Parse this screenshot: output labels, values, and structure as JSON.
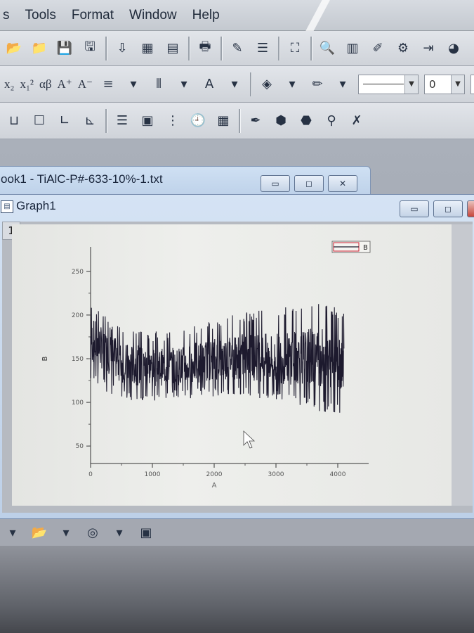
{
  "menu": [
    {
      "label": "s"
    },
    {
      "label": "Tools"
    },
    {
      "label": "Format"
    },
    {
      "label": "Window"
    },
    {
      "label": "Help"
    }
  ],
  "toolbar2": {
    "subscript": "x₂",
    "superscript": "x₁²",
    "greek": "αβ",
    "font_up": "A⁺",
    "font_down": "A⁻",
    "line_width_value": "",
    "number_value": "0"
  },
  "workbook": {
    "title": "ook1 - TiAlC-P#-633-10%-1.txt"
  },
  "graph_window": {
    "title": "Graph1",
    "layer_number": "1"
  },
  "icons": {
    "minimize": "▭",
    "restore": "◻",
    "close": "✕"
  },
  "chart_data": {
    "type": "line",
    "xlabel": "A",
    "ylabel": "B",
    "legend": {
      "entries": [
        "B"
      ],
      "placement": "top-right"
    },
    "xlim": [
      0,
      4500
    ],
    "ylim": [
      30,
      270
    ],
    "x_ticks": [
      0,
      1000,
      2000,
      3000,
      4000
    ],
    "y_ticks": [
      50,
      100,
      150,
      200,
      250
    ],
    "grid": false,
    "series": [
      {
        "name": "B",
        "color": "#1d1a2e",
        "x_range": [
          0,
          4100
        ],
        "envelope": [
          {
            "x": 0,
            "low": 125,
            "high": 220
          },
          {
            "x": 300,
            "low": 110,
            "high": 195
          },
          {
            "x": 700,
            "low": 100,
            "high": 185
          },
          {
            "x": 1200,
            "low": 103,
            "high": 180
          },
          {
            "x": 1700,
            "low": 105,
            "high": 190
          },
          {
            "x": 2200,
            "low": 108,
            "high": 200
          },
          {
            "x": 2700,
            "low": 105,
            "high": 205
          },
          {
            "x": 3200,
            "low": 100,
            "high": 210
          },
          {
            "x": 3700,
            "low": 90,
            "high": 215
          },
          {
            "x": 4100,
            "low": 85,
            "high": 205
          }
        ],
        "mean": [
          {
            "x": 0,
            "y": 172
          },
          {
            "x": 500,
            "y": 145
          },
          {
            "x": 1000,
            "y": 140
          },
          {
            "x": 1500,
            "y": 142
          },
          {
            "x": 2000,
            "y": 150
          },
          {
            "x": 2500,
            "y": 153
          },
          {
            "x": 3000,
            "y": 150
          },
          {
            "x": 3500,
            "y": 152
          },
          {
            "x": 4100,
            "y": 148
          }
        ]
      }
    ]
  }
}
